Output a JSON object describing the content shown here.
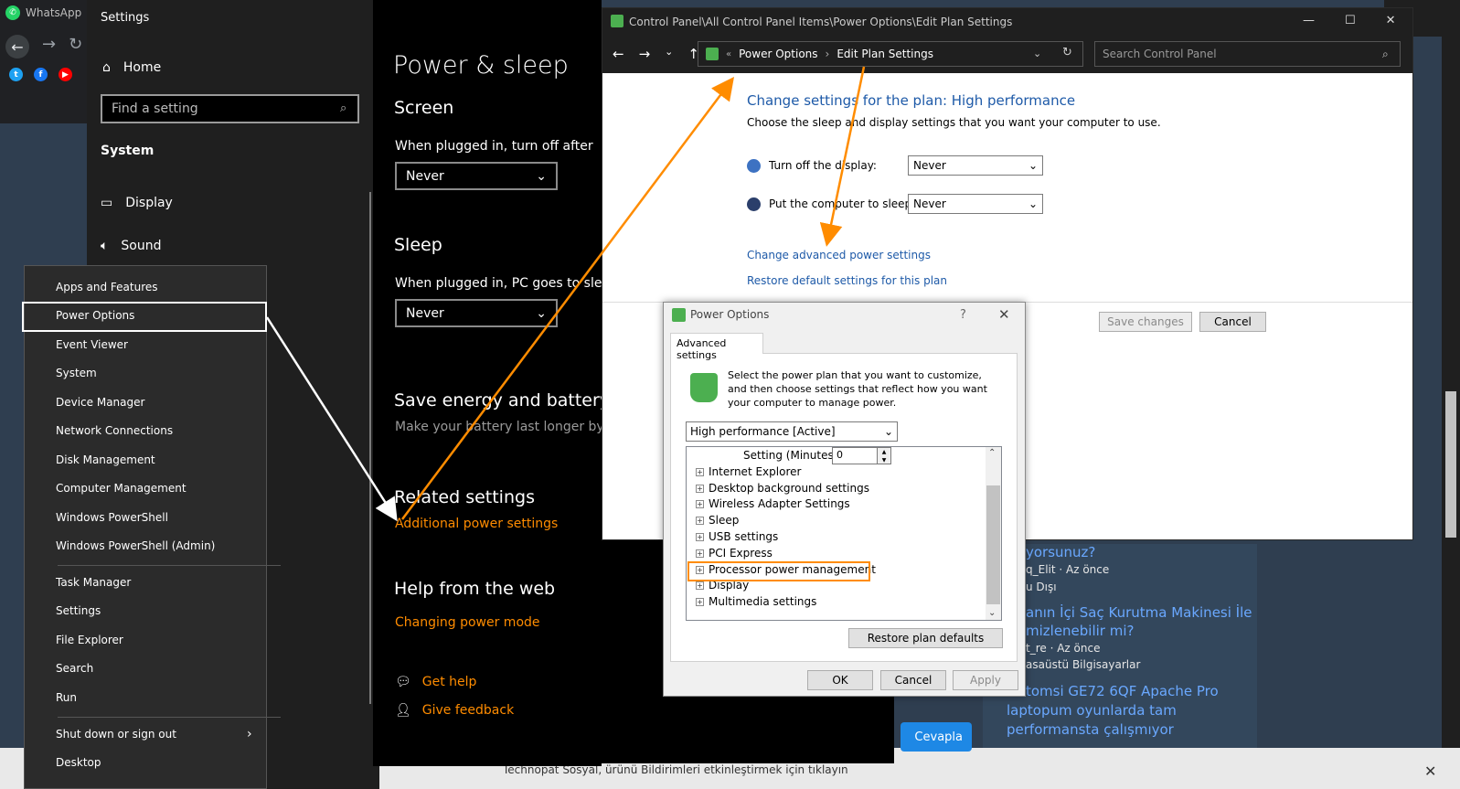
{
  "browser": {
    "tab_title": "WhatsApp",
    "bottom_text": "Technopat Sosyal, ürünü Bildirimleri etkinleştirmek için tıklayın",
    "bottom_link": "tıklayın"
  },
  "forum": {
    "items": [
      {
        "line1": "yorsunuz?",
        "meta1": "q_Elit · Az önce",
        "meta2": "u Dışı"
      },
      {
        "line1": "anın İçi Saç Kurutma Makinesi İle",
        "line2": "mizlenebilir mi?",
        "meta1": "t_re · Az önce",
        "meta2": "asaüstü Bilgisayarlar"
      },
      {
        "line1": "tomsi GE72 6QF Apache Pro",
        "line2": "laptopum oyunlarda tam",
        "line3": "performansta çalışmıyor"
      }
    ],
    "reply_label": "Cevapla"
  },
  "settings": {
    "window_title": "Settings",
    "home_label": "Home",
    "search_placeholder": "Find a setting",
    "system_label": "System",
    "display_label": "Display",
    "sound_label": "Sound",
    "page_title": "Power & sleep",
    "screen_heading": "Screen",
    "screen_label": "When plugged in, turn off after",
    "screen_value": "Never",
    "sleep_heading": "Sleep",
    "sleep_label": "When plugged in, PC goes to sleep af",
    "sleep_value": "Never",
    "save_heading": "Save energy and battery lif",
    "save_sub": "Make your battery last longer by choo",
    "related_heading": "Related settings",
    "related_link": "Additional power settings",
    "help_heading": "Help from the web",
    "help_link": "Changing power mode",
    "get_help": "Get help",
    "give_feedback": "Give feedback"
  },
  "winx_menu": {
    "group1": [
      "Apps and Features",
      "Power Options",
      "Event Viewer",
      "System",
      "Device Manager",
      "Network Connections",
      "Disk Management",
      "Computer Management",
      "Windows PowerShell",
      "Windows PowerShell (Admin)"
    ],
    "group2": [
      "Task Manager",
      "Settings",
      "File Explorer",
      "Search",
      "Run"
    ],
    "group3": [
      "Shut down or sign out",
      "Desktop"
    ]
  },
  "control_panel": {
    "window_title": "Control Panel\\All Control Panel Items\\Power Options\\Edit Plan Settings",
    "breadcrumb_1": "Power Options",
    "breadcrumb_2": "Edit Plan Settings",
    "search_placeholder": "Search Control Panel",
    "heading": "Change settings for the plan: High performance",
    "subheading": "Choose the sleep and display settings that you want your computer to use.",
    "display_label": "Turn off the display:",
    "display_value": "Never",
    "sleep_label": "Put the computer to sleep:",
    "sleep_value": "Never",
    "advanced_link": "Change advanced power settings",
    "restore_link": "Restore default settings for this plan",
    "save_button": "Save changes",
    "cancel_button": "Cancel"
  },
  "power_dialog": {
    "title": "Power Options",
    "help": "?",
    "tab_label": "Advanced settings",
    "description": "Select the power plan that you want to customize, and then choose settings that reflect how you want your computer to manage power.",
    "plan_value": "High performance [Active]",
    "setting_label": "Setting (Minutes):",
    "setting_value": "0",
    "tree_items": [
      "Internet Explorer",
      "Desktop background settings",
      "Wireless Adapter Settings",
      "Sleep",
      "USB settings",
      "PCI Express",
      "Processor power management",
      "Display",
      "Multimedia settings"
    ],
    "restore_button": "Restore plan defaults",
    "ok_button": "OK",
    "cancel_button": "Cancel",
    "apply_button": "Apply"
  },
  "colors": {
    "accent_orange": "#ff8c00",
    "link_blue": "#1e5aa8",
    "highlight_white": "#ffffff"
  }
}
